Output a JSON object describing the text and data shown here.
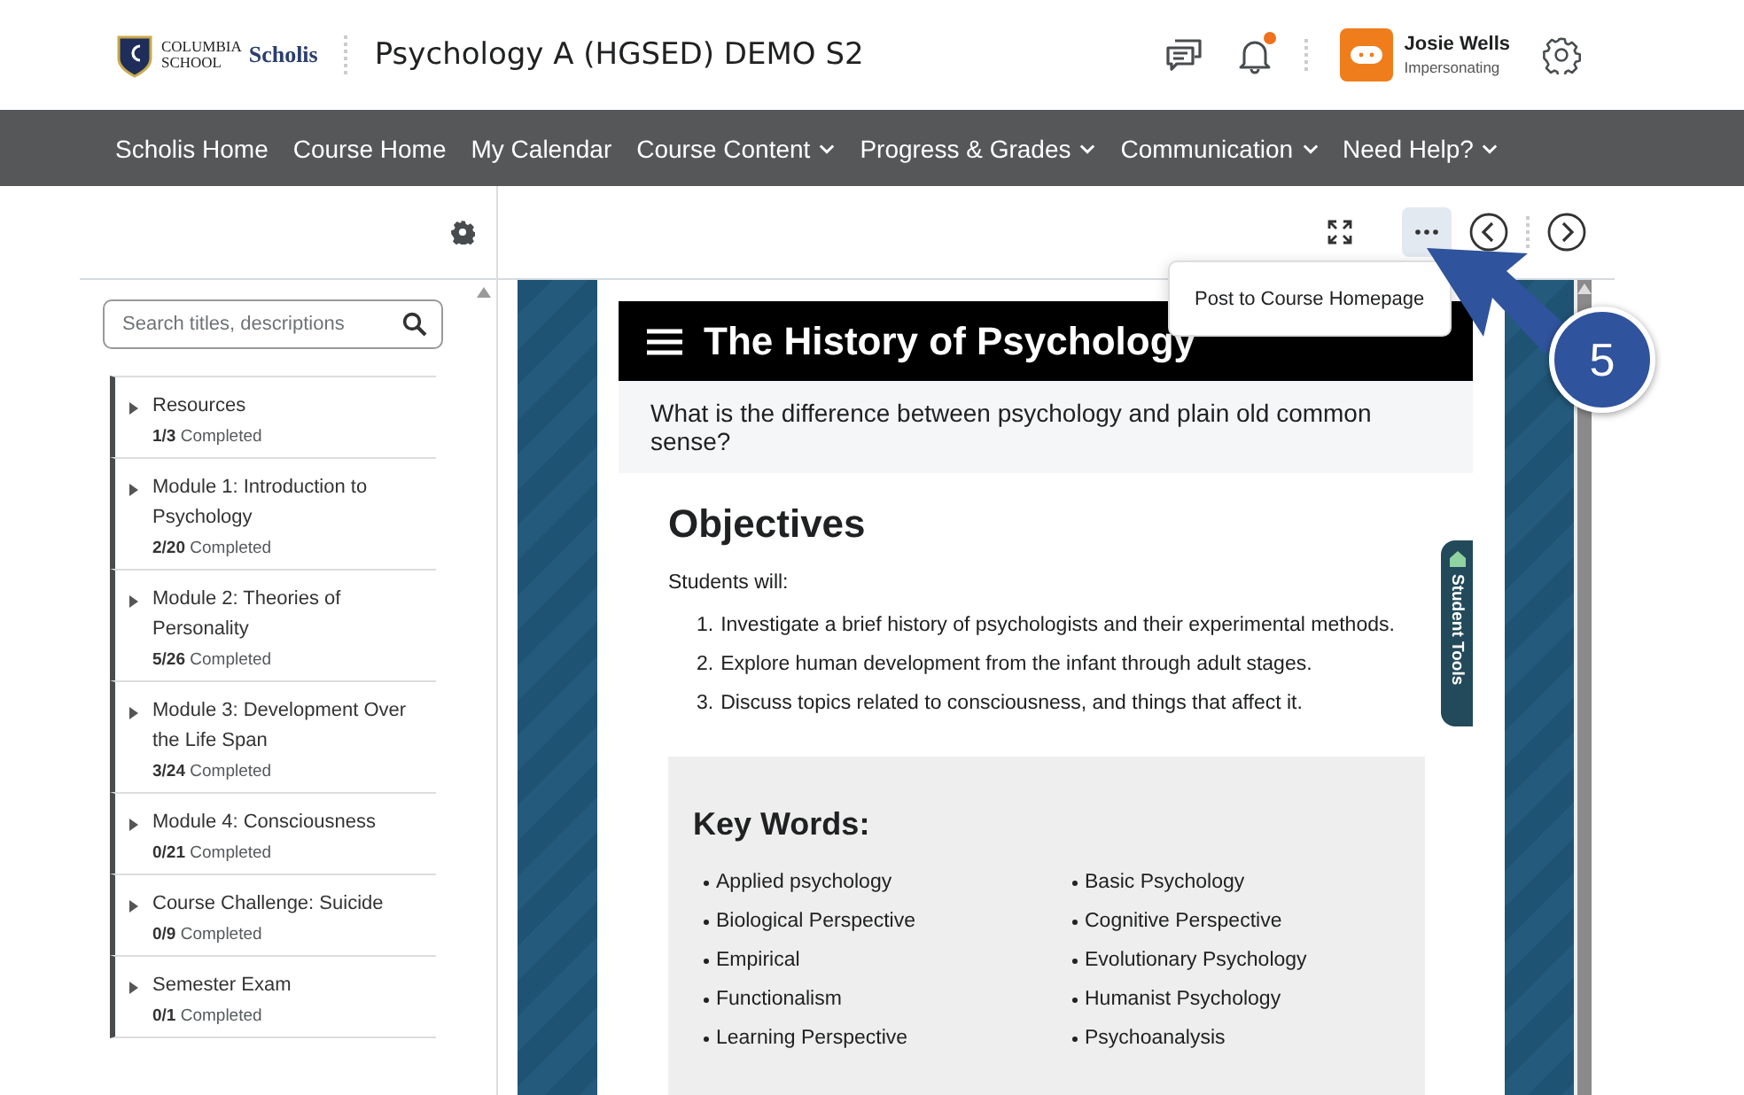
{
  "header": {
    "logo": {
      "line1": "COLUMBIA",
      "line2": "SCHOOL",
      "brand": "Scholis"
    },
    "course_title": "Psychology A (HGSED) DEMO S2",
    "notifications": {
      "unread": true
    },
    "user": {
      "name": "Josie Wells",
      "role": "Impersonating"
    }
  },
  "nav": [
    {
      "label": "Scholis Home",
      "dropdown": false
    },
    {
      "label": "Course Home",
      "dropdown": false
    },
    {
      "label": "My Calendar",
      "dropdown": false
    },
    {
      "label": "Course Content",
      "dropdown": true
    },
    {
      "label": "Progress & Grades",
      "dropdown": true
    },
    {
      "label": "Communication",
      "dropdown": true
    },
    {
      "label": "Need Help?",
      "dropdown": true
    }
  ],
  "sidebar": {
    "search": {
      "placeholder": "Search titles, descriptions"
    },
    "modules": [
      {
        "title": "Resources",
        "count": "1/3",
        "status": "Completed",
        "expanded": false
      },
      {
        "title": "Module 1: Introduction to Psychology",
        "count": "2/20",
        "status": "Completed",
        "expanded": false
      },
      {
        "title": "Module 2: Theories of Personality",
        "count": "5/26",
        "status": "Completed",
        "expanded": false
      },
      {
        "title": "Module 3: Development Over the Life Span",
        "count": "3/24",
        "status": "Completed",
        "expanded": false
      },
      {
        "title": "Module 4: Consciousness",
        "count": "0/21",
        "status": "Completed",
        "expanded": false
      },
      {
        "title": "Course Challenge: Suicide",
        "count": "0/9",
        "status": "Completed",
        "expanded": false
      },
      {
        "title": "Semester Exam",
        "count": "0/1",
        "status": "Completed",
        "expanded": false
      }
    ]
  },
  "toolbar": {
    "more_button": {
      "pressed": true
    },
    "popup_menu": [
      "Post to Course Homepage"
    ]
  },
  "document": {
    "title": "The History of Psychology",
    "question": "What is the difference between psychology and plain old common sense?",
    "objectives_heading": "Objectives",
    "intro": "Students will:",
    "objectives": [
      {
        "number": "1.",
        "text": "Investigate a brief history of psychologists and their experimental methods."
      },
      {
        "number": "2.",
        "text": "Explore human development from the infant through adult stages."
      },
      {
        "number": "3.",
        "text": "Discuss topics related to consciousness, and things that affect it."
      }
    ],
    "key_words_heading": "Key Words:",
    "key_words": [
      "Applied psychology",
      "Basic Psychology",
      "Biological Perspective",
      "Cognitive Perspective",
      "Empirical",
      "Evolutionary Psychology",
      "Functionalism",
      "Humanist Psychology",
      "Learning Perspective",
      "Psychoanalysis"
    ]
  },
  "side_tab": {
    "label": "Student Tools"
  },
  "callout": {
    "number": "5"
  }
}
